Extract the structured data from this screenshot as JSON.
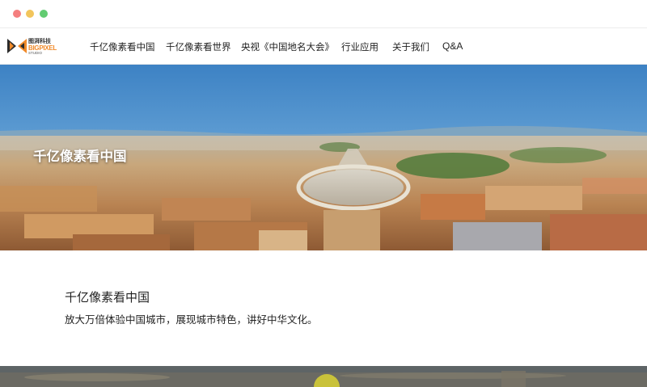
{
  "window": {
    "controls": [
      "close",
      "minimize",
      "maximize"
    ]
  },
  "brand": {
    "name_cn": "图湃科技",
    "name_en": "BIGPIXEL",
    "sub": "STUDIO",
    "accent_color": "#f08a2a"
  },
  "nav": {
    "items": [
      {
        "label": "千亿像素看中国"
      },
      {
        "label": "千亿像素看世界"
      },
      {
        "label": "央视《中国地名大会》"
      },
      {
        "label": "行业应用"
      },
      {
        "label": "关于我们"
      },
      {
        "label": "Q&A"
      }
    ]
  },
  "hero": {
    "title": "千亿像素看中国"
  },
  "section": {
    "title": "千亿像素看中国",
    "description": "放大万倍体验中国城市，展现城市特色，讲好中华文化。"
  }
}
